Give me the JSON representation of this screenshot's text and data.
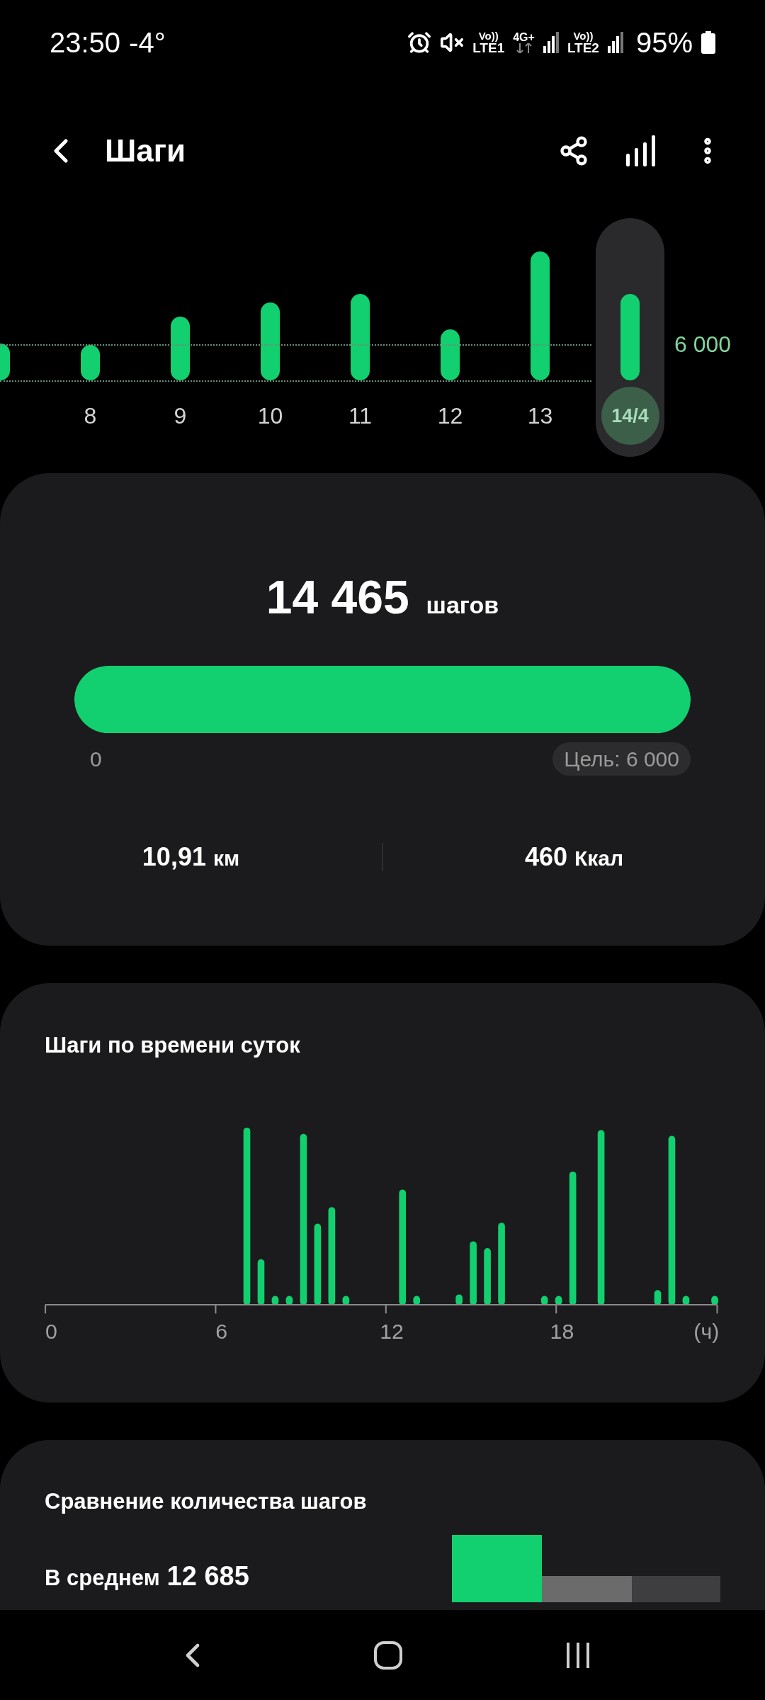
{
  "status_bar": {
    "time": "23:50",
    "temperature": "-4°",
    "sim1": {
      "volte": "Vo))",
      "network": "LTE1"
    },
    "data": "4G+",
    "sim2": {
      "volte": "Vo))",
      "network": "LTE2"
    },
    "battery": "95%"
  },
  "header": {
    "title": "Шаги"
  },
  "days": [
    {
      "selected": false
    },
    {
      "label": "8",
      "selected": false
    },
    {
      "label": "9",
      "selected": false
    },
    {
      "label": "10",
      "selected": false
    },
    {
      "label": "11",
      "selected": false
    },
    {
      "label": "12",
      "selected": false
    },
    {
      "label": "13",
      "selected": false
    },
    {
      "label": "14/4",
      "selected": true
    }
  ],
  "goal_line": "6 000",
  "summary": {
    "steps": "14 465",
    "unit": "шагов",
    "level": 1,
    "start": "0",
    "goal": "Цель: 6 000",
    "stats": [
      {
        "value": "10,91",
        "unit": "км"
      },
      {
        "value": "460",
        "unit": "Ккал"
      }
    ]
  },
  "hourly": {
    "title": "Шаги по времени суток",
    "axis_labels": [
      "0",
      "6",
      "12",
      "18",
      "(ч)"
    ]
  },
  "comparison": {
    "title": "Сравнение количества шагов",
    "label": "В среднем",
    "value": "12 685"
  }
}
